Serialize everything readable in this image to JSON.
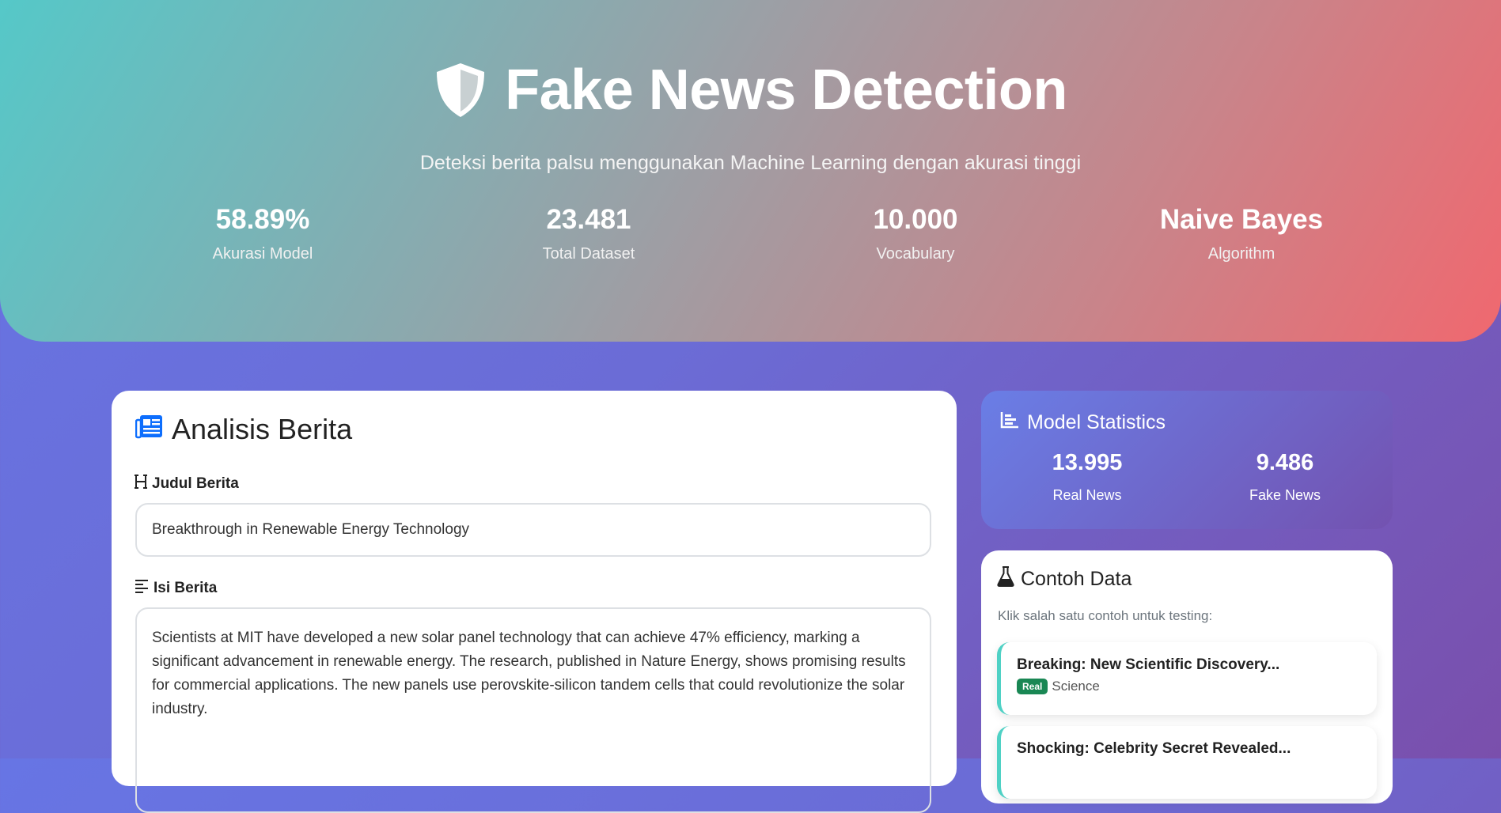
{
  "hero": {
    "title": "Fake News Detection",
    "subtitle": "Deteksi berita palsu menggunakan Machine Learning dengan akurasi tinggi",
    "stats": [
      {
        "value": "58.89%",
        "label": "Akurasi Model"
      },
      {
        "value": "23.481",
        "label": "Total Dataset"
      },
      {
        "value": "10.000",
        "label": "Vocabulary"
      },
      {
        "value": "Naive Bayes",
        "label": "Algorithm"
      }
    ]
  },
  "analysis": {
    "title": "Analisis Berita",
    "title_label": "Judul Berita",
    "title_value": "Breakthrough in Renewable Energy Technology",
    "content_label": "Isi Berita",
    "content_value": "Scientists at MIT have developed a new solar panel technology that can achieve 47% efficiency, marking a significant advancement in renewable energy. The research, published in Nature Energy, shows promising results for commercial applications. The new panels use perovskite-silicon tandem cells that could revolutionize the solar industry."
  },
  "model_stats": {
    "title": "Model Statistics",
    "real": {
      "value": "13.995",
      "label": "Real News"
    },
    "fake": {
      "value": "9.486",
      "label": "Fake News"
    }
  },
  "examples": {
    "title": "Contoh Data",
    "hint": "Klik salah satu contoh untuk testing:",
    "items": [
      {
        "title": "Breaking: New Scientific Discovery...",
        "badge": "Real",
        "category": "Science"
      },
      {
        "title": "Shocking: Celebrity Secret Revealed..."
      }
    ]
  },
  "colors": {
    "primary": "#0d6efd",
    "real_badge": "#198754",
    "accent_border": "#4fd1c5"
  },
  "icons": [
    "shield-icon",
    "newspaper-icon",
    "heading-icon",
    "align-left-icon",
    "chart-bar-icon",
    "flask-icon"
  ]
}
